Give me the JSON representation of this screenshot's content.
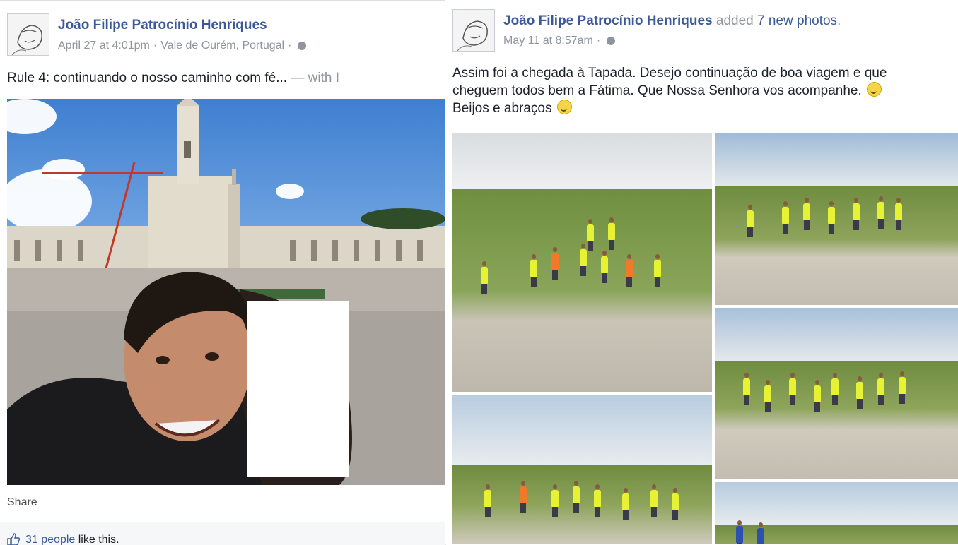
{
  "left_post": {
    "author": "João Filipe Patrocínio Henriques",
    "date": "April 27 at 4:01pm",
    "location": "Vale de Ourém, Portugal",
    "text": "Rule 4: continuando o nosso caminho com fé...",
    "with_text": " — with I",
    "share_label": "Share",
    "likes_count": "31 people",
    "likes_suffix": " like this."
  },
  "right_post": {
    "author": "João Filipe Patrocínio Henriques",
    "action_prefix": " added ",
    "action_count": "7 new photos",
    "action_suffix": ".",
    "date": "May 11 at 8:57am",
    "text_line1": "Assim foi a chegada à Tapada. Desejo continuação de boa viagem e que",
    "text_line2": "cheguem todos bem a Fátima. Que Nossa Senhora vos acompanhe.",
    "text_line3": "Beijos e abraços"
  },
  "separator": "·",
  "icons": [
    "globe-icon",
    "smiley-icon",
    "like-thumb-icon"
  ],
  "colors": {
    "link": "#3b5998",
    "meta": "#90949c",
    "text": "#1d2129",
    "vest": "#e7f233"
  }
}
